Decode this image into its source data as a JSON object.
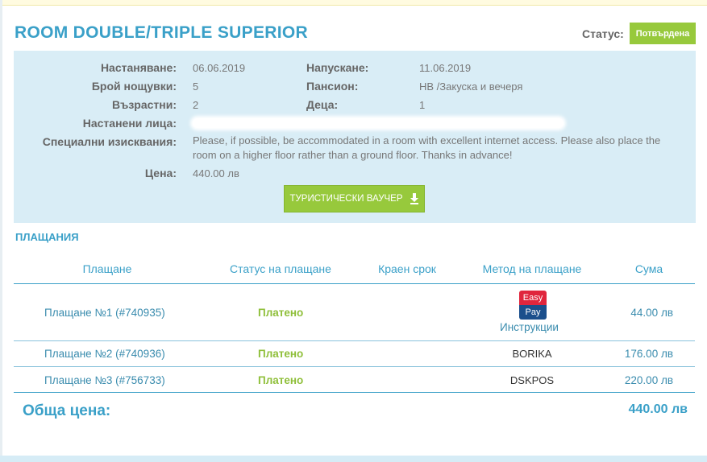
{
  "room": {
    "title": "ROOM DOUBLE/TRIPLE SUPERIOR"
  },
  "status": {
    "label": "Статус:",
    "value": "Потвърдена"
  },
  "details": {
    "checkin_label": "Настаняване:",
    "checkin": "06.06.2019",
    "checkout_label": "Напускане:",
    "checkout": "11.06.2019",
    "nights_label": "Брой нощувки:",
    "nights": "5",
    "board_label": "Пансион:",
    "board": "HB /Закуска и вечеря",
    "adults_label": "Възрастни:",
    "adults": "2",
    "children_label": "Деца:",
    "children": "1",
    "guests_label": "Настанени лица:",
    "requests_label": "Специални изисквания:",
    "requests": "Please, if possible, be accommodated in a room with excellent internet access. Please also place the room on a higher floor rather than a ground floor. Thanks in advance!",
    "price_label": "Цена:",
    "price": "440.00 лв",
    "voucher_button": "ТУРИСТИЧЕСКИ ВАУЧЕР",
    "voucher_icon": "download-icon"
  },
  "payments": {
    "title": "ПЛАЩАНИЯ",
    "headers": [
      "Плащане",
      "Статус на плащане",
      "Краен срок",
      "Метод на плащане",
      "Сума"
    ],
    "rows": [
      {
        "name": "Плащане №1 (#740935)",
        "status": "Платено",
        "method": "",
        "method_logo_top": "Easy",
        "method_logo_bottom": "Pay",
        "method_link": "Инструкции",
        "amount": "44.00 лв"
      },
      {
        "name": "Плащане №2 (#740936)",
        "status": "Платено",
        "method": "BORIKA",
        "amount": "176.00 лв"
      },
      {
        "name": "Плащане №3 (#756733)",
        "status": "Платено",
        "method": "DSKPOS",
        "amount": "220.00 лв"
      }
    ],
    "total_label": "Обща цена:",
    "total_value": "440.00 лв"
  },
  "colors": {
    "accent": "#3aa0c8",
    "green": "#97c93c",
    "panel": "#d9edf6"
  }
}
